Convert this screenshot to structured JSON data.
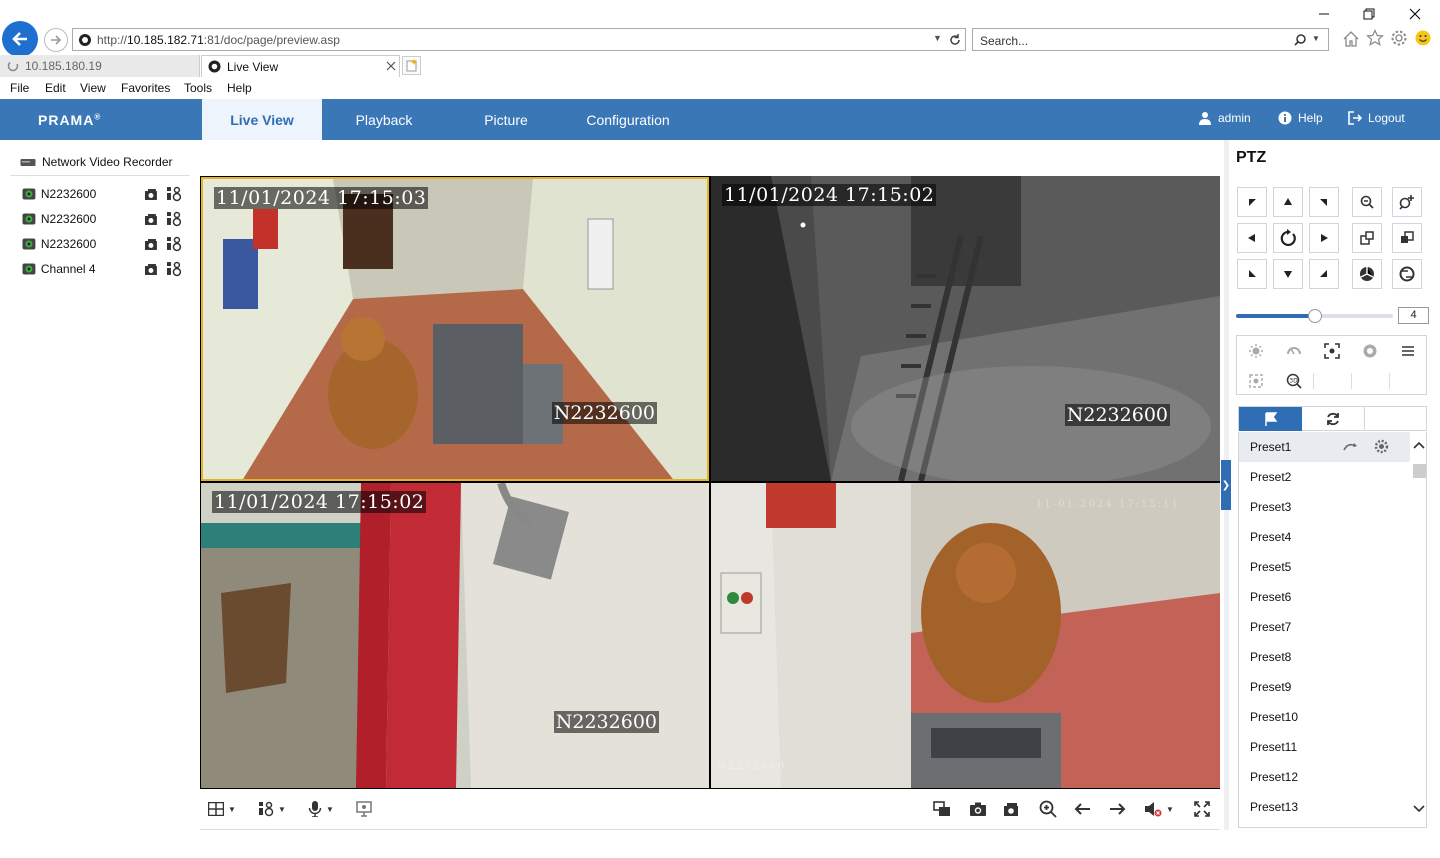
{
  "browser": {
    "url_prefix": "http://",
    "url_host": "10.185.182.71",
    "url_rest": ":81/doc/page/preview.asp",
    "search_placeholder": "Search...",
    "tabs": [
      {
        "label": "10.185.180.19"
      },
      {
        "label": "Live View"
      }
    ],
    "menu": [
      "File",
      "Edit",
      "View",
      "Favorites",
      "Tools",
      "Help"
    ]
  },
  "app": {
    "logo": "PRAMA",
    "nav": [
      "Live View",
      "Playback",
      "Picture",
      "Configuration"
    ],
    "user": "admin",
    "help": "Help",
    "logout": "Logout",
    "accent": "#3a77b7"
  },
  "tree": {
    "root": "Network Video Recorder",
    "channels": [
      "N2232600",
      "N2232600",
      "N2232600",
      "Channel 4"
    ]
  },
  "tiles": [
    {
      "timestamp": "11/01/2024 17:15:03",
      "camera": "N2232600"
    },
    {
      "timestamp": "11/01/2024 17:15:02",
      "camera": "N2232600"
    },
    {
      "timestamp": "11/01/2024 17:15:02",
      "camera": "N2232600"
    },
    {
      "timestamp": "11-01-2024 17:15:11",
      "camera": "N2232600"
    }
  ],
  "ptz": {
    "title": "PTZ",
    "speed": "4",
    "speed_level": 0.5,
    "presets": [
      "Preset1",
      "Preset2",
      "Preset3",
      "Preset4",
      "Preset5",
      "Preset6",
      "Preset7",
      "Preset8",
      "Preset9",
      "Preset10",
      "Preset11",
      "Preset12",
      "Preset13"
    ]
  }
}
